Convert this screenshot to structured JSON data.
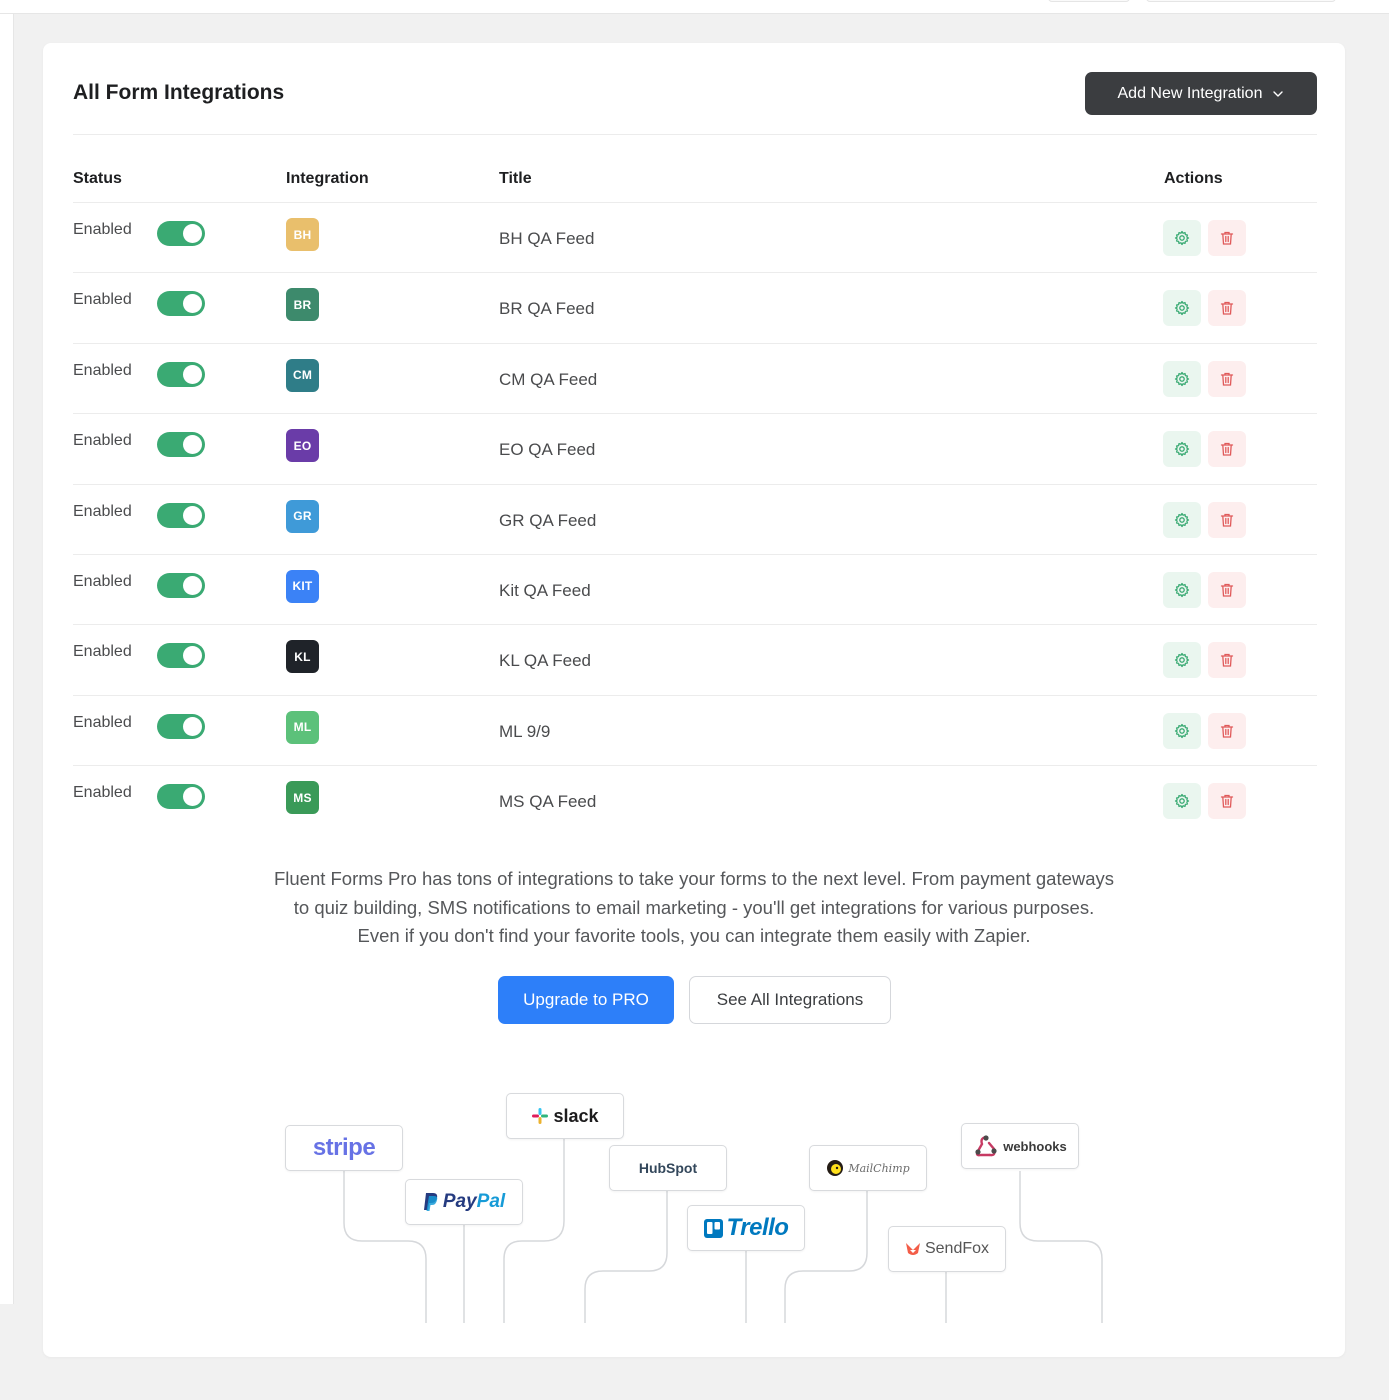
{
  "page": {
    "title": "All Form Integrations",
    "add_button_label": "Add New Integration"
  },
  "table": {
    "headers": {
      "status": "Status",
      "integration": "Integration",
      "title": "Title",
      "actions": "Actions"
    },
    "rows": [
      {
        "status": "Enabled",
        "enabled": true,
        "badge": "BH",
        "badge_color": "#e9bf6c",
        "title": "BH QA Feed"
      },
      {
        "status": "Enabled",
        "enabled": true,
        "badge": "BR",
        "badge_color": "#3d8a6c",
        "title": "BR QA Feed"
      },
      {
        "status": "Enabled",
        "enabled": true,
        "badge": "CM",
        "badge_color": "#2f7d88",
        "title": "CM QA Feed"
      },
      {
        "status": "Enabled",
        "enabled": true,
        "badge": "EO",
        "badge_color": "#6a3ca8",
        "title": "EO QA Feed"
      },
      {
        "status": "Enabled",
        "enabled": true,
        "badge": "GR",
        "badge_color": "#3f9ad8",
        "title": "GR QA Feed"
      },
      {
        "status": "Enabled",
        "enabled": true,
        "badge": "KIT",
        "badge_color": "#3b82f6",
        "title": "Kit QA Feed"
      },
      {
        "status": "Enabled",
        "enabled": true,
        "badge": "KL",
        "badge_color": "#1f2329",
        "title": "KL QA Feed"
      },
      {
        "status": "Enabled",
        "enabled": true,
        "badge": "ML",
        "badge_color": "#5cc17a",
        "title": "ML 9/9"
      },
      {
        "status": "Enabled",
        "enabled": true,
        "badge": "MS",
        "badge_color": "#3a9a58",
        "title": "MS QA Feed"
      }
    ]
  },
  "promo": {
    "line1": "Fluent Forms Pro has tons of integrations to take your forms to the next level. From payment gateways",
    "line2": "to quiz building, SMS notifications to email marketing - you'll get integrations for various purposes.",
    "line3": "Even if you don't find your favorite tools, you can integrate them easily with Zapier.",
    "upgrade_label": "Upgrade to PRO",
    "see_all_label": "See All Integrations"
  },
  "logos": {
    "stripe": "stripe",
    "slack": "slack",
    "paypal_pay": "Pay",
    "paypal_pal": "Pal",
    "hubspot": "HubSpot",
    "trello": "Trello",
    "mailchimp": "MailChimp",
    "sendfox": "SendFox",
    "webhooks": "webhooks"
  },
  "colors": {
    "toggle_on": "#3aaa73",
    "primary": "#2d7ff9",
    "dark_button": "#3b3d40",
    "settings_icon": "#3aaa73",
    "delete_icon": "#e05a5a"
  },
  "icons": {
    "dropdown": "chevron-down-icon",
    "settings": "gear-icon",
    "delete": "trash-icon"
  }
}
